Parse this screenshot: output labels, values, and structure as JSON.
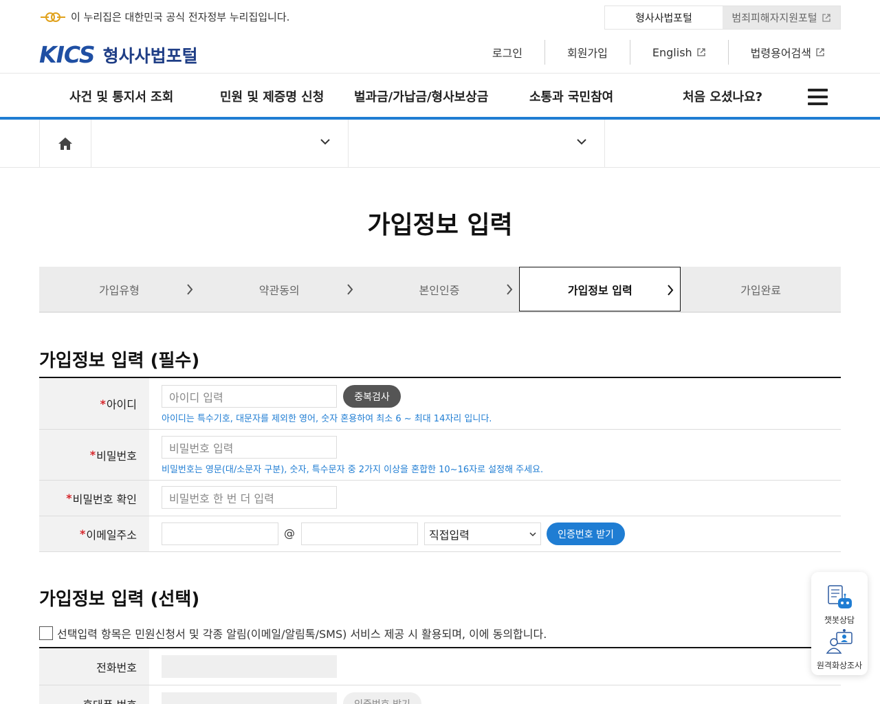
{
  "gov_bar": {
    "notice": "이 누리집은 대한민국 공식 전자정부 누리집입니다.",
    "portal_tabs": [
      "형사사법포털",
      "범죄피해자지원포털"
    ]
  },
  "header": {
    "logo_mark": "KICS",
    "logo_text": "형사사법포털",
    "util_nav": [
      "로그인",
      "회원가입",
      "English",
      "법령용어검색"
    ]
  },
  "gnb": {
    "items": [
      "사건 및 통지서 조회",
      "민원 및 제증명 신청",
      "벌과금/가납금/형사보상금",
      "소통과 국민참여",
      "처음 오셨나요?"
    ]
  },
  "page_title": "가입정보 입력",
  "steps": {
    "items": [
      "가입유형",
      "약관동의",
      "본인인증",
      "가입정보 입력",
      "가입완료"
    ],
    "current_index": 3
  },
  "required_section": {
    "title": "가입정보 입력 (필수)",
    "id": {
      "label": "아이디",
      "placeholder": "아이디 입력",
      "button": "중복검사",
      "hint": "아이디는 특수기호, 대문자를 제외한 영어, 숫자 혼용하여 최소 6 ~ 최대 14자리 입니다."
    },
    "password": {
      "label": "비밀번호",
      "placeholder": "비밀번호 입력",
      "hint": "비밀번호는 영문(대/소문자 구분), 숫자, 특수문자 중 2가지 이상을 혼합한 10~16자로 설정해 주세요."
    },
    "password_confirm": {
      "label": "비밀번호 확인",
      "placeholder": "비밀번호 한 번 더 입력"
    },
    "email": {
      "label": "이메일주소",
      "at": "@",
      "domain_select": "직접입력",
      "button": "인증번호 받기"
    },
    "required_mark": "*"
  },
  "optional_section": {
    "title": "가입정보 입력 (선택)",
    "consent": "선택입력 항목은 민원신청서 및 각종 알림(이메일/알림톡/SMS) 서비스 제공 시 활용되며, 이에 동의합니다.",
    "phone_label": "전화번호",
    "mobile_label": "휴대폰 번호",
    "mobile_button": "인증번호 받기"
  },
  "float_widget": {
    "chatbot": "챗봇상담",
    "video": "원격화상조사"
  },
  "colors": {
    "accent_blue": "#1f7dd3",
    "logo_blue": "#1f4fa3",
    "required_red": "#d6262b"
  }
}
